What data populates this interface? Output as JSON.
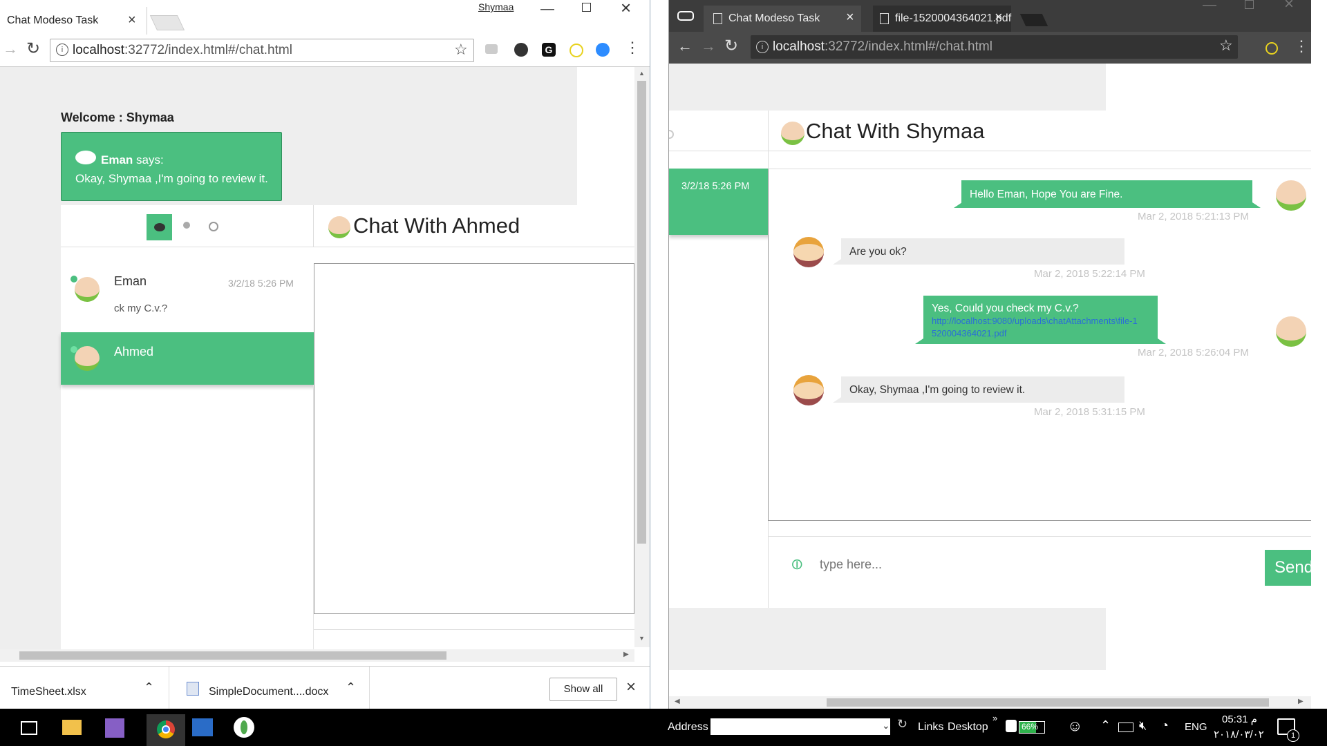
{
  "left_window": {
    "tab_title": "Chat Modeso Task",
    "profile_name": "Shymaa",
    "url_host": "localhost",
    "url_rest": ":32772/index.html#/chat.html",
    "welcome": "Welcome : Shymaa",
    "notification": {
      "sender": "Eman",
      "says": " says:",
      "message": "Okay, Shymaa ,I'm going to review it."
    },
    "contacts": [
      {
        "name": "Eman",
        "time": "3/2/18 5:26 PM",
        "preview": "ck my C.v.?"
      },
      {
        "name": "Ahmed",
        "time": "",
        "preview": ""
      }
    ],
    "chat_title": "Chat With Ahmed",
    "downloads": [
      {
        "name": "TimeSheet.xlsx"
      },
      {
        "name": "SimpleDocument....docx"
      }
    ],
    "show_all": "Show all"
  },
  "right_window": {
    "tabs": [
      {
        "title": "Chat Modeso Task"
      },
      {
        "title": "file-1520004364021.pdf"
      }
    ],
    "url_host": "localhost",
    "url_rest": ":32772/index.html#/chat.html",
    "chat_title": "Chat With Shymaa",
    "contact_time": "3/2/18 5:26 PM",
    "messages": [
      {
        "from": "me",
        "text": "Hello Eman, Hope You are Fine.",
        "link": "",
        "time": "Mar 2, 2018 5:21:13 PM"
      },
      {
        "from": "other",
        "text": "Are you ok?",
        "link": "",
        "time": "Mar 2, 2018 5:22:14 PM"
      },
      {
        "from": "me",
        "text": "Yes, Could you check my C.v.?",
        "link": "http://localhost:9080/uploads\\chatAttachments\\file-1520004364021.pdf",
        "time": "Mar 2, 2018 5:26:04 PM"
      },
      {
        "from": "other",
        "text": "Okay, Shymaa ,I'm going to review it.",
        "link": "",
        "time": "Mar 2, 2018 5:31:15 PM"
      }
    ],
    "input_placeholder": "type here...",
    "send_label": "Send"
  },
  "taskbar": {
    "address_label": "Address",
    "links_label": "Links",
    "desktop_label": "Desktop",
    "battery": "66%",
    "language": "ENG",
    "time": "05:31 م",
    "date": "٢٠١٨/٠٣/٠٢",
    "notification_count": "1"
  },
  "colors": {
    "accent": "#4bbf80",
    "taskbar": "#000000",
    "chrome_dark": "#3c3c3c"
  }
}
